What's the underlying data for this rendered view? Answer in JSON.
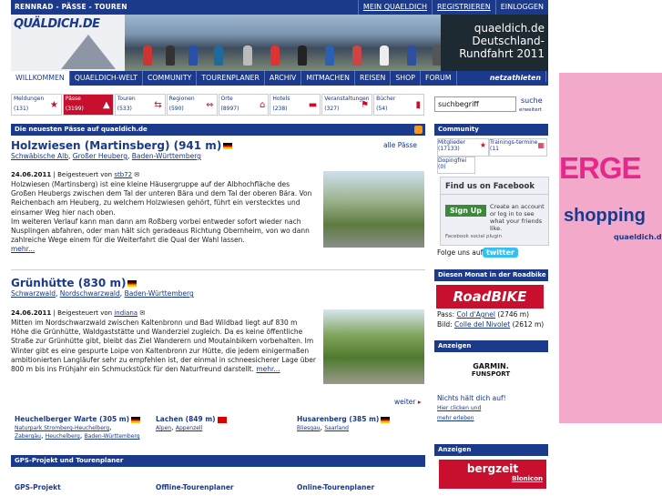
{
  "top": {
    "brand": "RENNRAD - PÄSSE - TOUREN",
    "links": [
      "MEIN QUAELDICH",
      "REGISTRIEREN",
      "EINLOGGEN"
    ]
  },
  "header": {
    "logo": "QUÄLDICH.DE",
    "promo": [
      "quaeldich.de",
      "Deutschland-",
      "Rundfahrt 2011"
    ]
  },
  "nav": {
    "items": [
      "WILLKOMMEN",
      "QUAELDICH-WELT",
      "COMMUNITY",
      "TOURENPLANER",
      "ARCHIV",
      "MITMACHEN",
      "REISEN",
      "SHOP",
      "FORUM"
    ],
    "active_index": 0,
    "netz": "netzathleten"
  },
  "categories": [
    {
      "label": "Meldungen",
      "count": "(131)",
      "icon": "star-icon"
    },
    {
      "label": "Pässe",
      "count": "(3199)",
      "icon": "mountain-icon"
    },
    {
      "label": "Touren",
      "count": "(533)",
      "icon": "arrows-icon"
    },
    {
      "label": "Regionen",
      "count": "(590)",
      "icon": "arrows-icon"
    },
    {
      "label": "Orte",
      "count": "(8997)",
      "icon": "house-icon"
    },
    {
      "label": "Hotels",
      "count": "(238)",
      "icon": "bed-icon"
    },
    {
      "label": "Veranstaltungen",
      "count": "(327)",
      "icon": "flag-icon"
    },
    {
      "label": "Bücher",
      "count": "(54)",
      "icon": "book-icon"
    }
  ],
  "search": {
    "value": "suchbegriff",
    "go": "suche",
    "extended": "erweitert"
  },
  "main": {
    "section_title": "Die neuesten Pässe auf quaeldich.de",
    "alle_label": "alle Pässe",
    "passes": [
      {
        "title": "Holzwiesen (Martinsberg) (941 m)",
        "regions": [
          "Schwäbische Alb",
          "Großer Heuberg",
          "Baden-Württemberg"
        ],
        "date": "24.06.2011",
        "contrib_prefix": "| Beigesteuert von",
        "author": "stb72",
        "text": "Holzwiesen (Martinsberg) ist eine kleine Häusergruppe auf der Albhochfläche des Großen Heubergs zwischen dem Tal der unteren Bära und dem Tal der oberen Bära. Von Reichenbach am Heuberg, zu welchem Holzwiesen gehört, führt ein verstecktes und einsamer Weg hier nach oben.",
        "text2": "Im weiteren Verlauf kann man dann am Roßberg vorbei entweder sofort wieder nach Nusplingen abfahren, oder man hält sich geradeaus Richtung Obernheim, von wo dann zahlreiche Wege einem für die Weiterfahrt die Qual der Wahl lassen.",
        "more": "mehr..."
      },
      {
        "title": "Grünhütte (830 m)",
        "regions": [
          "Schwarzwald",
          "Nordschwarzwald",
          "Baden-Württemberg"
        ],
        "date": "24.06.2011",
        "contrib_prefix": "| Beigesteuert von",
        "author": "indiana",
        "text": "Mitten im Nordschwarzwald zwischen Kaltenbronn und Bad Wildbad liegt auf 830 m Höhe die Grünhütte, Waldgaststätte und Wanderziel zugleich. Da es keine öffentliche Straße zur Grünhütte gibt, bleibt das Ziel Wanderern und Moutainbikern vorbehalten. Im Winter gibt es eine gespurte Loipe von Kaltenbronn zur Hütte, die jedem einigermaßen ambitionierten Langläufer sehr zu empfehlen ist, der einmal in schneesicherer Lage über 800 m bis ins Frühjahr ein Schmuckstück für den Naturfreund darstellt.",
        "more": "mehr..."
      }
    ],
    "weiter": "weiter",
    "minis": [
      {
        "title": "Heuchelberger Warte (305 m)",
        "regions": [
          "Naturpark Stromberg-Heuchelberg",
          "Zabergäu",
          "Heuchelberg",
          "Baden-Württemberg"
        ]
      },
      {
        "title": "Lachen (849 m)",
        "regions": [
          "Alpen",
          "Appenzell"
        ]
      },
      {
        "title": "Husarenberg (385 m)",
        "regions": [
          "Bliesgau",
          "Saarland"
        ]
      }
    ],
    "gps_section": "GPS-Projekt und Tourenplaner",
    "gps_cols": [
      "GPS-Projekt",
      "Offline-Tourenplaner",
      "Online-Tourenplaner"
    ]
  },
  "community": {
    "title": "Community",
    "items": [
      {
        "label": "Mitglieder",
        "count": "(17133)"
      },
      {
        "label": "Trainings-termine",
        "count": "(11"
      },
      {
        "label": "Dopingfrei",
        "count": "(0)"
      }
    ]
  },
  "facebook": {
    "title": "Find us on Facebook",
    "signup": "Sign Up",
    "text": "Create an account or log in to see what your friends like.",
    "plugin": "Facebook social plugin"
  },
  "twitter": {
    "label": "Folge uns auf",
    "brand": "twitter"
  },
  "month": {
    "title": "Diesen Monat in der Roadbike",
    "logo": "RoadBIKE",
    "pass_label": "Pass:",
    "pass": "Col d'Agnel",
    "pass_height": "(2746 m)",
    "bild_label": "Bild:",
    "bild": "Colle del Nivolet",
    "bild_height": "(2612 m)"
  },
  "ads": {
    "title": "Anzeigen",
    "garmin": "GARMIN.",
    "garmin_sub": "FUNSPORT",
    "nichts": "Nichts hält dich auf!",
    "hier": "Hier clicken und",
    "mehr": "mehr erleben",
    "title2": "Anzeigen",
    "bergzeit": "bergzeit",
    "blonicon": "Blonicon"
  },
  "side_promo": {
    "big": "ERGE",
    "shop": "shopping",
    "small": "quaeldich.de"
  }
}
